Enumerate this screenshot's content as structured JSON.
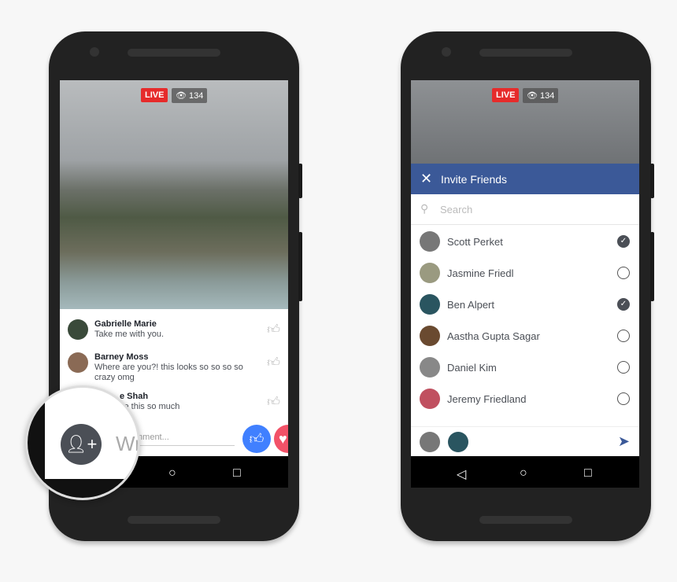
{
  "left_phone": {
    "live_badge": "LIVE",
    "viewer_count": "134",
    "comments": [
      {
        "name": "Gabrielle Marie",
        "text": "Take me with you.",
        "avatar_color": "#3a4a3a"
      },
      {
        "name": "Barney Moss",
        "text": "Where are you?! this looks so so so so crazy omg",
        "avatar_color": "#8a6a55"
      },
      {
        "name": "e Shah",
        "text": "ve this so much",
        "avatar_color": "#777"
      }
    ],
    "comment_placeholder": "mment...",
    "magnifier_placeholder": "Wr"
  },
  "right_phone": {
    "live_badge": "LIVE",
    "viewer_count": "134",
    "header_title": "Invite Friends",
    "search_placeholder": "Search",
    "friends": [
      {
        "name": "Scott Perket",
        "selected": true,
        "avatar_color": "#777"
      },
      {
        "name": "Jasmine Friedl",
        "selected": false,
        "avatar_color": "#9a9a80"
      },
      {
        "name": "Ben Alpert",
        "selected": true,
        "avatar_color": "#2a5560"
      },
      {
        "name": "Aastha Gupta Sagar",
        "selected": false,
        "avatar_color": "#6a4a30"
      },
      {
        "name": "Daniel Kim",
        "selected": false,
        "avatar_color": "#888"
      },
      {
        "name": "Jeremy Friedland",
        "selected": false,
        "avatar_color": "#c05060"
      }
    ]
  },
  "colors": {
    "facebook_blue": "#3b5998",
    "live_red": "#e62b2b",
    "like_blue": "#4080ff",
    "love_red": "#f25268"
  }
}
